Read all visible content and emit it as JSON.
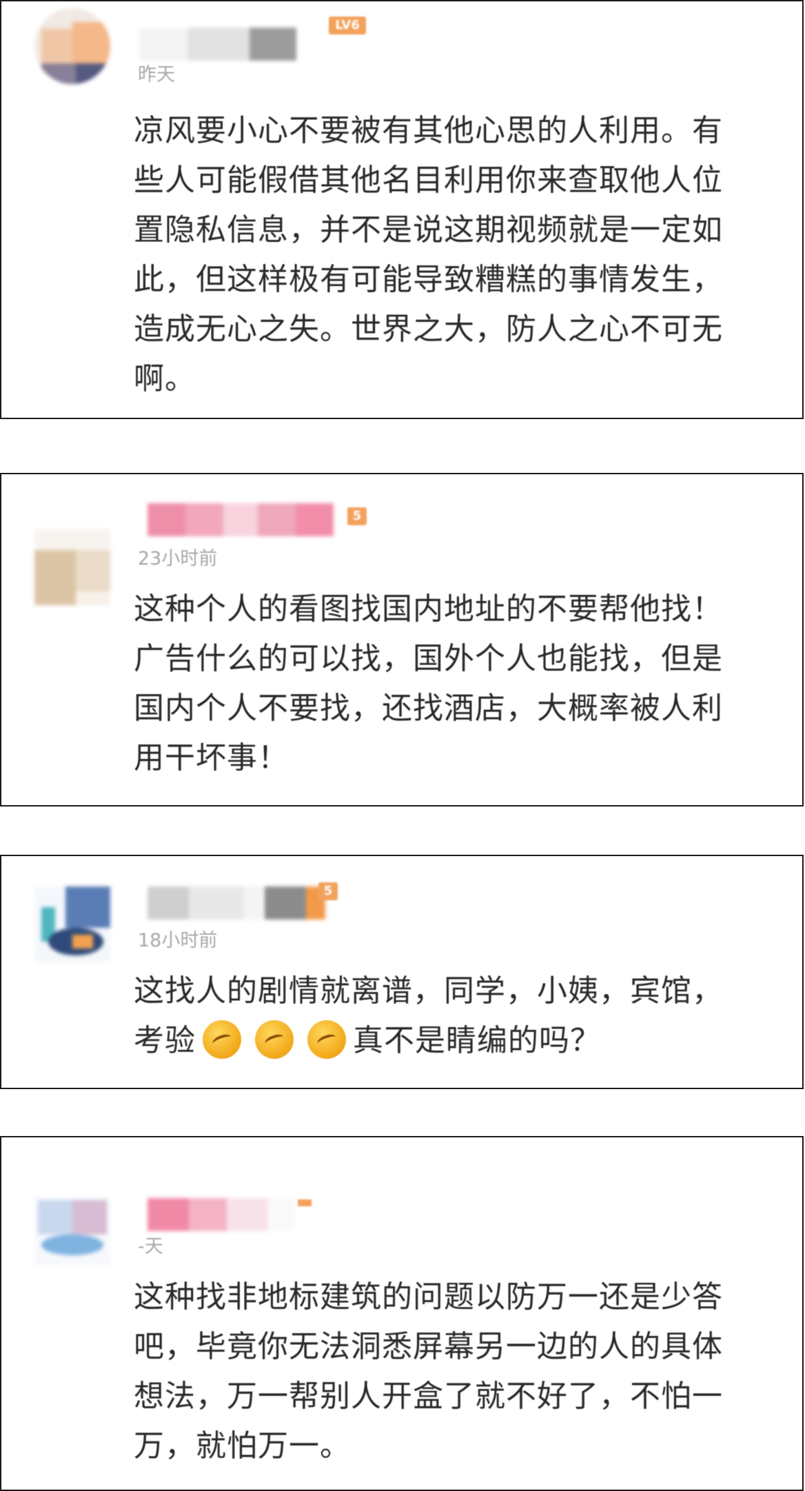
{
  "comments": [
    {
      "time": "昨天",
      "badge": "LV6",
      "text": "凉风要小心不要被有其他心思的人利用。有\n些人可能假借其他名目利用你来查取他人位\n置隐私信息，并不是说这期视频就是一定如\n此，但这样极有可能导致糟糕的事情发生，\n造成无心之失。世界之大，防人之心不可无\n啊。"
    },
    {
      "time": "23小时前",
      "badge": "5",
      "text": "这种个人的看图找国内地址的不要帮他找！\n广告什么的可以找，国外个人也能找，但是\n国内个人不要找，还找酒店，大概率被人利\n用干坏事！"
    },
    {
      "time": "18小时前",
      "badge": "5",
      "text_before_emoji": "这找人的剧情就离谱，同学，小姨，宾馆，\n考验",
      "emoji": [
        "dizzy-face-emoji",
        "dizzy-face-emoji",
        "dizzy-face-emoji"
      ],
      "text_after_emoji": "真不是睛编的吗？"
    },
    {
      "time": "-天",
      "badge": "",
      "text": "这种找非地标建筑的问题以防万一还是少答\n吧，毕竟你无法洞悉屏幕另一边的人的具体\n想法，万一帮别人开盒了就不好了，不怕一\n万，就怕万一。"
    }
  ],
  "colors": {
    "badge": "#f3a25c",
    "timestamp": "#a8a8a8",
    "text": "#2a2a2a",
    "border": "#1a1a1a"
  }
}
